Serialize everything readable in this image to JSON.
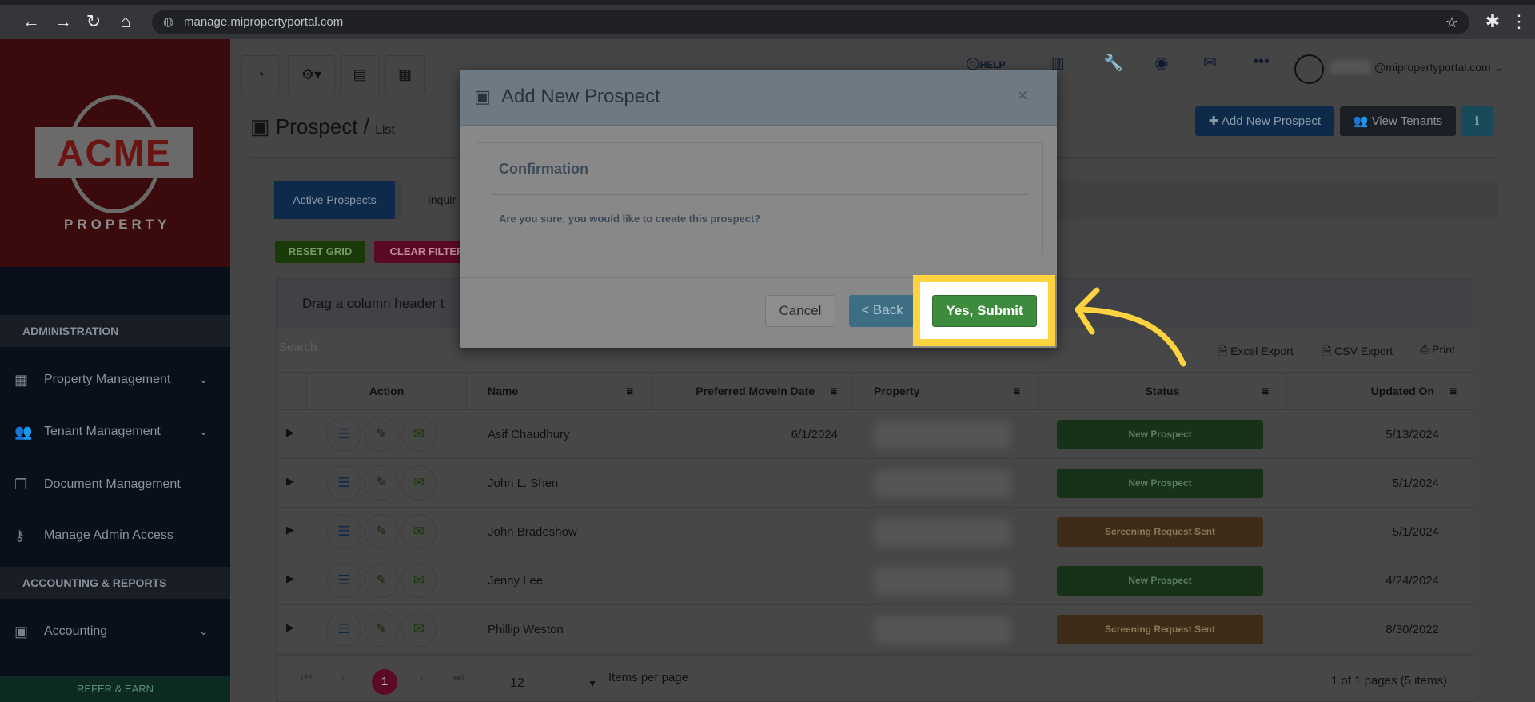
{
  "browser": {
    "url": "manage.mipropertyportal.com"
  },
  "logo": {
    "name": "ACME",
    "sub": "PROPERTY"
  },
  "sidebar": {
    "sections": [
      "ADMINISTRATION",
      "ACCOUNTING & REPORTS"
    ],
    "items": [
      {
        "label": "Property Management"
      },
      {
        "label": "Tenant Management"
      },
      {
        "label": "Document Management"
      },
      {
        "label": "Manage Admin Access"
      },
      {
        "label": "Accounting"
      }
    ],
    "refer": "REFER & EARN"
  },
  "topbar": {
    "help": "HELP",
    "user_email": "@mipropertyportal.com"
  },
  "page": {
    "title": "Prospect",
    "sub": "List",
    "add_button": "Add New Prospect",
    "view_tenants": "View Tenants"
  },
  "tabs": [
    "Active Prospects",
    "Inquir"
  ],
  "grid": {
    "reset": "RESET GRID",
    "clear": "CLEAR FILTER",
    "group_hint": "Drag a column header t",
    "search_placeholder": "Search",
    "exports": [
      "Excel Export",
      "CSV Export",
      "Print"
    ],
    "columns": [
      "Action",
      "Name",
      "Preferred MoveIn Date",
      "Property",
      "Status",
      "Updated On"
    ],
    "rows": [
      {
        "name": "Asif Chaudhury",
        "movein": "6/1/2024",
        "status": "New Prospect",
        "updated": "5/13/2024"
      },
      {
        "name": "John L. Shen",
        "movein": "",
        "status": "New Prospect",
        "updated": "5/1/2024"
      },
      {
        "name": "John Bradeshow",
        "movein": "",
        "status": "Screening Request Sent",
        "updated": "5/1/2024"
      },
      {
        "name": "Jenny Lee",
        "movein": "",
        "status": "New Prospect",
        "updated": "4/24/2024"
      },
      {
        "name": "Phillip Weston",
        "movein": "",
        "status": "Screening Request Sent",
        "updated": "8/30/2022"
      }
    ],
    "pager": {
      "page": "1",
      "size": "12",
      "per_page": "Items per page",
      "summary": "1 of 1 pages (5 items)"
    }
  },
  "modal": {
    "title": "Add New Prospect",
    "close": "×",
    "heading": "Confirmation",
    "message": "Are you sure, you would like to create this prospect?",
    "cancel": "Cancel",
    "back": "< Back",
    "submit": "Yes, Submit"
  },
  "colors": {
    "green": "#5cb85c",
    "orange": "#f0ad4e",
    "highlight": "#ffd23f"
  }
}
